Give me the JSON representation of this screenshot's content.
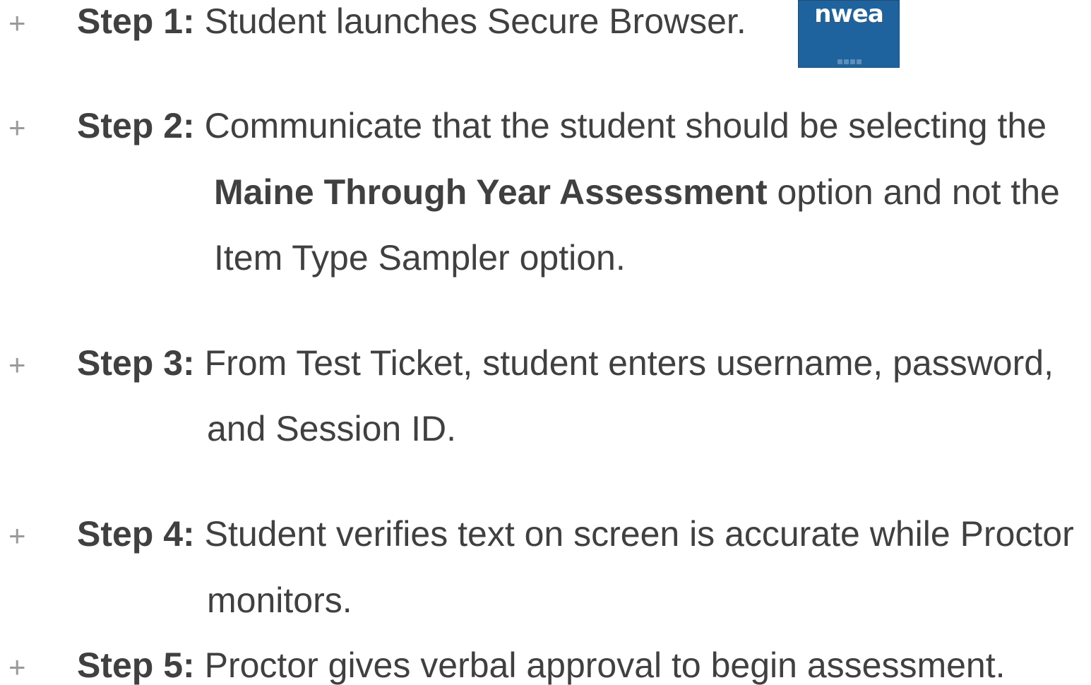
{
  "logo": {
    "text": "nwea",
    "background_color": "#1f639e",
    "text_color": "#ffffff"
  },
  "bullet_symbol": "+",
  "steps": [
    {
      "label": "Step 1:",
      "lines": [
        {
          "text": " Student launches Secure Browser."
        }
      ]
    },
    {
      "label": "Step 2:",
      "lines": [
        {
          "text": " Communicate that the student should be selecting the"
        },
        {
          "bold_text": "Maine Through Year Assessment",
          "text": " option and not the"
        },
        {
          "text": "Item Type Sampler option."
        }
      ]
    },
    {
      "label": "Step 3:",
      "lines": [
        {
          "text": " From Test Ticket, student enters username, password,"
        },
        {
          "text": "and Session ID."
        }
      ]
    },
    {
      "label": "Step 4:",
      "lines": [
        {
          "text": " Student verifies text on screen is accurate while Proctor"
        },
        {
          "text": "monitors."
        }
      ]
    },
    {
      "label": "Step 5:",
      "lines": [
        {
          "text": " Proctor gives verbal approval to begin assessment."
        }
      ]
    }
  ],
  "colors": {
    "text": "#404040",
    "bullet": "#9a9a9a"
  }
}
